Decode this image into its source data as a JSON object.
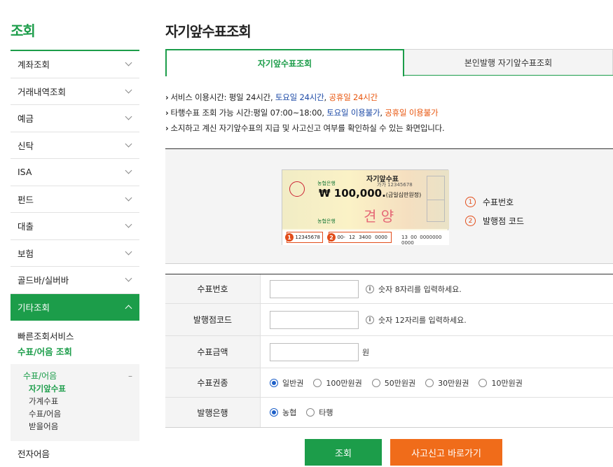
{
  "sidebar": {
    "title": "조회",
    "items": [
      {
        "label": "계좌조회"
      },
      {
        "label": "거래내역조회"
      },
      {
        "label": "예금"
      },
      {
        "label": "신탁"
      },
      {
        "label": "ISA"
      },
      {
        "label": "펀드"
      },
      {
        "label": "대출"
      },
      {
        "label": "보험"
      },
      {
        "label": "골드바/실버바"
      },
      {
        "label": "기타조회"
      }
    ],
    "sub1": "빠른조회서비스",
    "sub2": "수표/어음 조회",
    "box_head": "수표/어음",
    "box_minus": "–",
    "leaves": [
      "자기앞수표",
      "가계수표",
      "수표/어음",
      "받을어음"
    ],
    "sub3": "전자어음"
  },
  "main": {
    "title": "자기앞수표조회",
    "tab_on": "자기앞수표조회",
    "tab_off": "본인발행 자기앞수표조회",
    "notice1": {
      "a": "서비스 이용시간: 평일 24시간, ",
      "b": "토요일 24시간",
      "c": ", ",
      "d": "공휴일 24시간"
    },
    "notice2": {
      "a": "타행수표 조회 가능 시간:평일 07:00~18:00, ",
      "b": "토요일 이용불가",
      "c": ", ",
      "d": "공휴일 이용불가"
    },
    "notice3": "소지하고 계신 자기앞수표의 지급 및 사고신고 여부를 확인하실 수 있는 화면입니다.",
    "check": {
      "title": "자기앞수표",
      "serial": "가가 12345678",
      "amount": "₩ 100,000.",
      "amount_words": "(금일십만원정)",
      "bank1": "농협은행",
      "bank2": "농협은행",
      "stamp": "견 양",
      "box1": "12345678",
      "box2": "00-  12  3400   0000",
      "box3": "13 00 0000000 0000",
      "n1": "1",
      "n2": "2"
    },
    "legend": [
      {
        "num": "1",
        "text": "수표번호"
      },
      {
        "num": "2",
        "text": "발행점 코드"
      }
    ],
    "form": {
      "row1_label": "수표번호",
      "row1_hint": "숫자 8자리를 입력하세요.",
      "row2_label": "발행점코드",
      "row2_hint": "숫자 12자리를 입력하세요.",
      "row3_label": "수표금액",
      "row3_unit": "원",
      "row4_label": "수표권종",
      "row4_options": [
        "일반권",
        "100만원권",
        "50만원권",
        "30만원권",
        "10만원권"
      ],
      "row5_label": "발행은행",
      "row5_options": [
        "농협",
        "타행"
      ],
      "info": "i"
    },
    "btn_search": "조회",
    "btn_report": "사고신고 바로가기"
  }
}
